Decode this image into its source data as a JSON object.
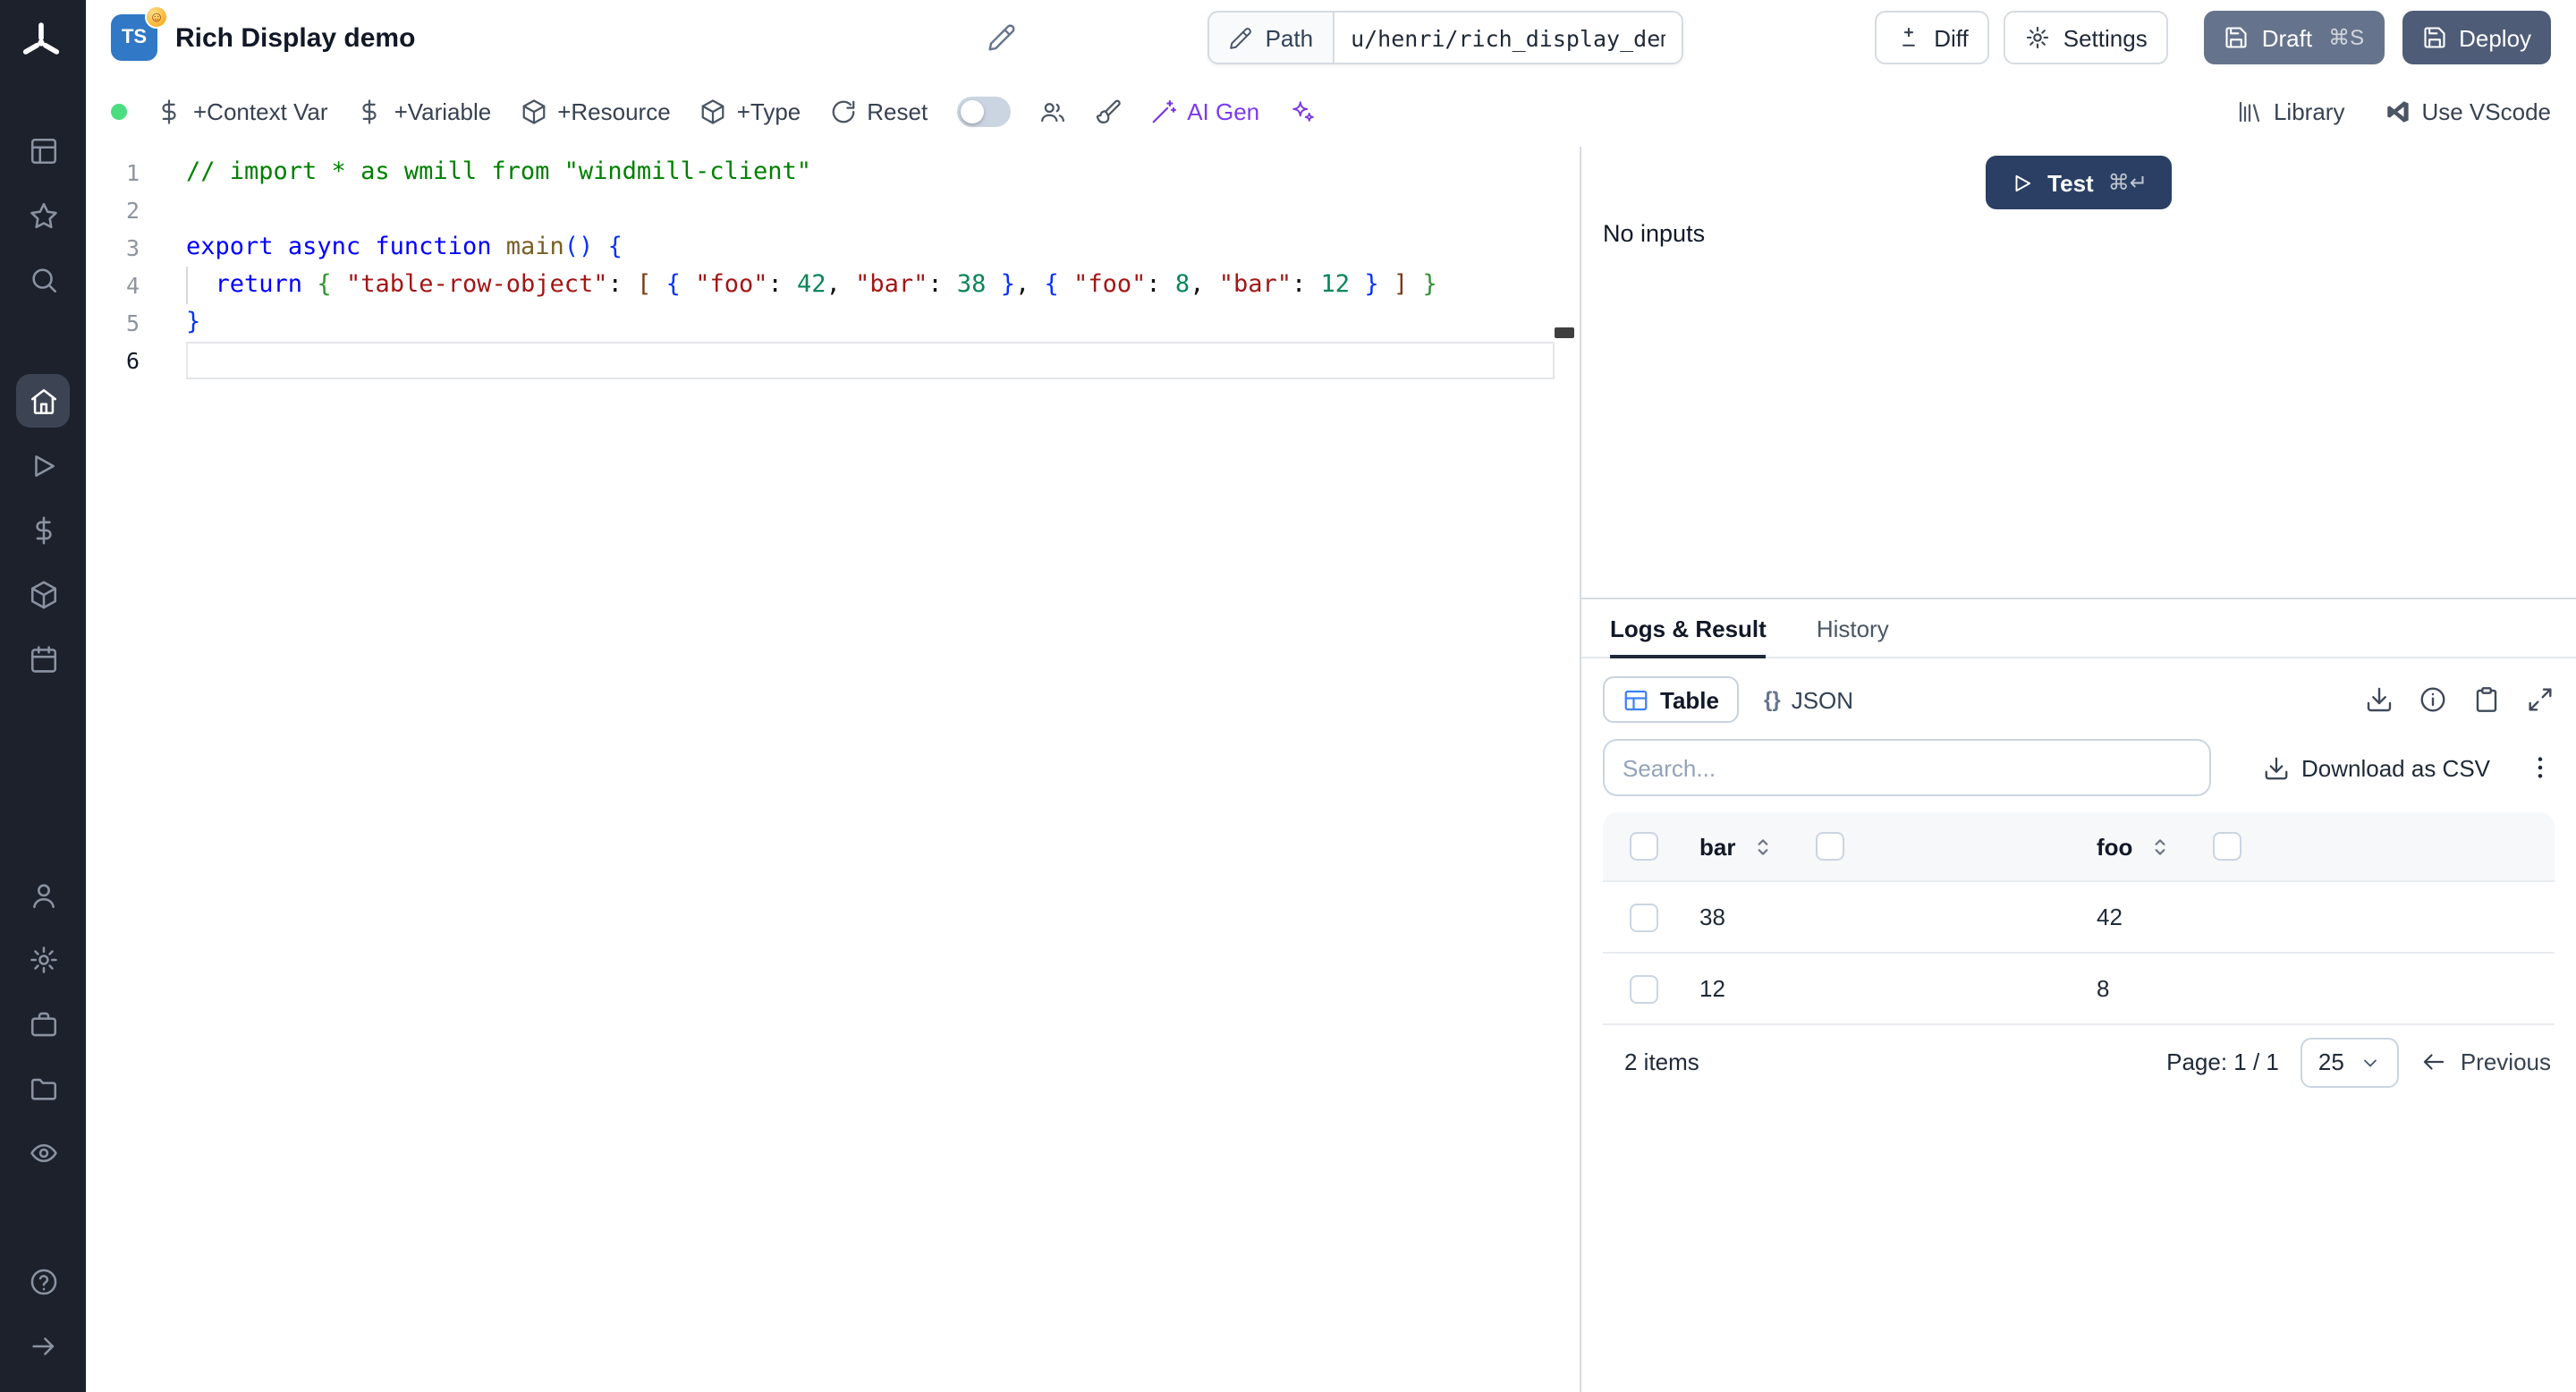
{
  "header": {
    "badge": "TS",
    "title": "Rich Display demo",
    "path_button": "Path",
    "path_value": "u/henri/rich_display_demo",
    "diff_label": "Diff",
    "settings_label": "Settings",
    "draft_label": "Draft",
    "draft_shortcut": "⌘S",
    "deploy_label": "Deploy"
  },
  "toolbar": {
    "context_var": "+Context Var",
    "variable": "+Variable",
    "resource": "+Resource",
    "type": "+Type",
    "reset": "Reset",
    "ai_gen": "AI Gen",
    "library": "Library",
    "use_vscode": "Use VScode"
  },
  "editor": {
    "active_line": 5,
    "indent_guide_line": 3,
    "lines": [
      [
        {
          "c": "cmt",
          "t": "// import * as wmill from \"windmill-client\""
        }
      ],
      [],
      [
        {
          "c": "kw",
          "t": "export"
        },
        {
          "c": "pl",
          "t": " "
        },
        {
          "c": "kw",
          "t": "async"
        },
        {
          "c": "pl",
          "t": " "
        },
        {
          "c": "kw",
          "t": "function"
        },
        {
          "c": "pl",
          "t": " "
        },
        {
          "c": "fn",
          "t": "main"
        },
        {
          "c": "b1",
          "t": "()"
        },
        {
          "c": "pl",
          "t": " "
        },
        {
          "c": "b1",
          "t": "{"
        }
      ],
      [
        {
          "c": "pl",
          "t": "  "
        },
        {
          "c": "kw",
          "t": "return"
        },
        {
          "c": "pl",
          "t": " "
        },
        {
          "c": "b2",
          "t": "{"
        },
        {
          "c": "pl",
          "t": " "
        },
        {
          "c": "str",
          "t": "\"table-row-object\""
        },
        {
          "c": "pl",
          "t": ": "
        },
        {
          "c": "b3",
          "t": "["
        },
        {
          "c": "pl",
          "t": " "
        },
        {
          "c": "b1",
          "t": "{"
        },
        {
          "c": "pl",
          "t": " "
        },
        {
          "c": "str",
          "t": "\"foo\""
        },
        {
          "c": "pl",
          "t": ": "
        },
        {
          "c": "num",
          "t": "42"
        },
        {
          "c": "pl",
          "t": ", "
        },
        {
          "c": "str",
          "t": "\"bar\""
        },
        {
          "c": "pl",
          "t": ": "
        },
        {
          "c": "num",
          "t": "38"
        },
        {
          "c": "pl",
          "t": " "
        },
        {
          "c": "b1",
          "t": "}"
        },
        {
          "c": "pl",
          "t": ", "
        },
        {
          "c": "b1",
          "t": "{"
        },
        {
          "c": "pl",
          "t": " "
        },
        {
          "c": "str",
          "t": "\"foo\""
        },
        {
          "c": "pl",
          "t": ": "
        },
        {
          "c": "num",
          "t": "8"
        },
        {
          "c": "pl",
          "t": ", "
        },
        {
          "c": "str",
          "t": "\"bar\""
        },
        {
          "c": "pl",
          "t": ": "
        },
        {
          "c": "num",
          "t": "12"
        },
        {
          "c": "pl",
          "t": " "
        },
        {
          "c": "b1",
          "t": "}"
        },
        {
          "c": "pl",
          "t": " "
        },
        {
          "c": "b3",
          "t": "]"
        },
        {
          "c": "pl",
          "t": " "
        },
        {
          "c": "b2",
          "t": "}"
        }
      ],
      [
        {
          "c": "b1",
          "t": "}"
        }
      ],
      []
    ]
  },
  "run_panel": {
    "test_label": "Test",
    "test_shortcut": "⌘↵",
    "no_inputs": "No inputs"
  },
  "result_panel": {
    "tabs": [
      {
        "label": "Logs & Result"
      },
      {
        "label": "History"
      }
    ],
    "view_table": "Table",
    "view_json_braces": "{}",
    "view_json": "JSON",
    "search_placeholder": "Search...",
    "download_csv": "Download as CSV",
    "table": {
      "columns": [
        "bar",
        "foo"
      ],
      "rows": [
        [
          "38",
          "42"
        ],
        [
          "12",
          "8"
        ]
      ],
      "items_text": "2 items",
      "page_text": "Page: 1 / 1",
      "page_size": "25",
      "previous_label": "Previous"
    }
  },
  "sidebar": {
    "items": [
      "apps",
      "favorites",
      "search",
      "home",
      "runs",
      "variables",
      "resources",
      "schedules",
      "account",
      "settings",
      "workers",
      "folders",
      "audit-logs",
      "help",
      "expand-sidebar"
    ]
  },
  "colors": {
    "sidebar_bg": "#1c212b",
    "ts_badge_blue": "#3178c6",
    "status_green": "#4ade80",
    "accent_violet": "#7c3aed",
    "test_button": "#2a3f63",
    "draft_button": "#66738c",
    "deploy_button": "#4e5c77",
    "table_icon_blue": "#3b82f6"
  }
}
